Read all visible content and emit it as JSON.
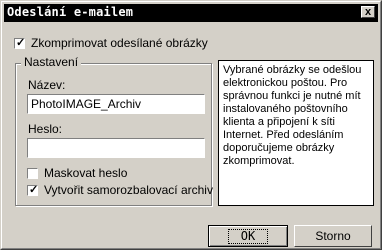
{
  "window": {
    "title": "Odeslání e-mailem",
    "close_label": "x"
  },
  "compress_checkbox": {
    "label": "Zkomprimovat odesílané obrázky",
    "checked": true
  },
  "settings_group": {
    "legend": "Nastavení",
    "name_label": "Název:",
    "name_value": "PhotoIMAGE_Archiv",
    "password_label": "Heslo:",
    "password_value": "",
    "mask_password": {
      "label": "Maskovat heslo",
      "checked": false
    },
    "self_extracting": {
      "label": "Vytvořit samorozbalovací archiv",
      "checked": true
    }
  },
  "info_text": "Vybrané obrázky se odešlou elektronickou poštou. Pro správnou funkci je nutné mít instalovaného poštovního klienta a připojení k síti Internet. Před odesláním doporučujeme obrázky zkomprimovat.",
  "buttons": {
    "ok": "OK",
    "cancel": "Storno"
  }
}
